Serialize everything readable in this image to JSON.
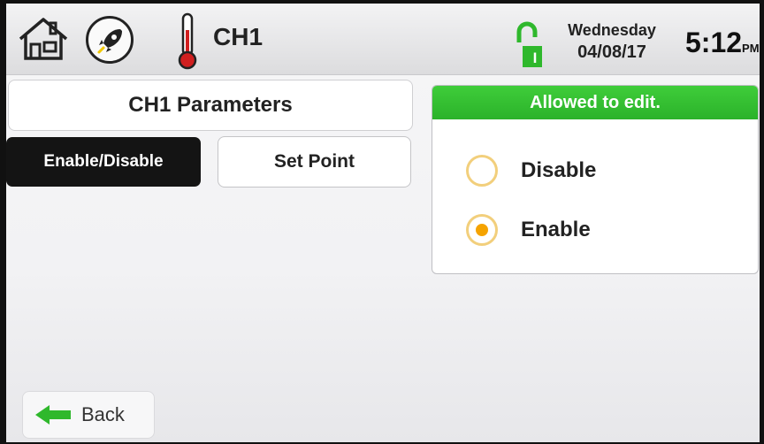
{
  "header": {
    "title": "CH1",
    "day": "Wednesday",
    "date": "04/08/17",
    "time": "5:12",
    "ampm": "PM",
    "icons": [
      "home-icon",
      "rocket-icon",
      "thermometer-icon",
      "unlocked-icon"
    ],
    "lock_letter": "I"
  },
  "left_panel": {
    "title": "CH1 Parameters",
    "buttons": [
      {
        "label": "Enable/Disable",
        "selected": true
      },
      {
        "label": "Set Point",
        "selected": false
      }
    ]
  },
  "edit_panel": {
    "status": "Allowed to edit.",
    "status_color": "#2fb82c",
    "options": [
      {
        "label": "Disable",
        "checked": false
      },
      {
        "label": "Enable",
        "checked": true
      }
    ]
  },
  "footer": {
    "back_label": "Back",
    "back_icon_color": "#2fb82c"
  }
}
